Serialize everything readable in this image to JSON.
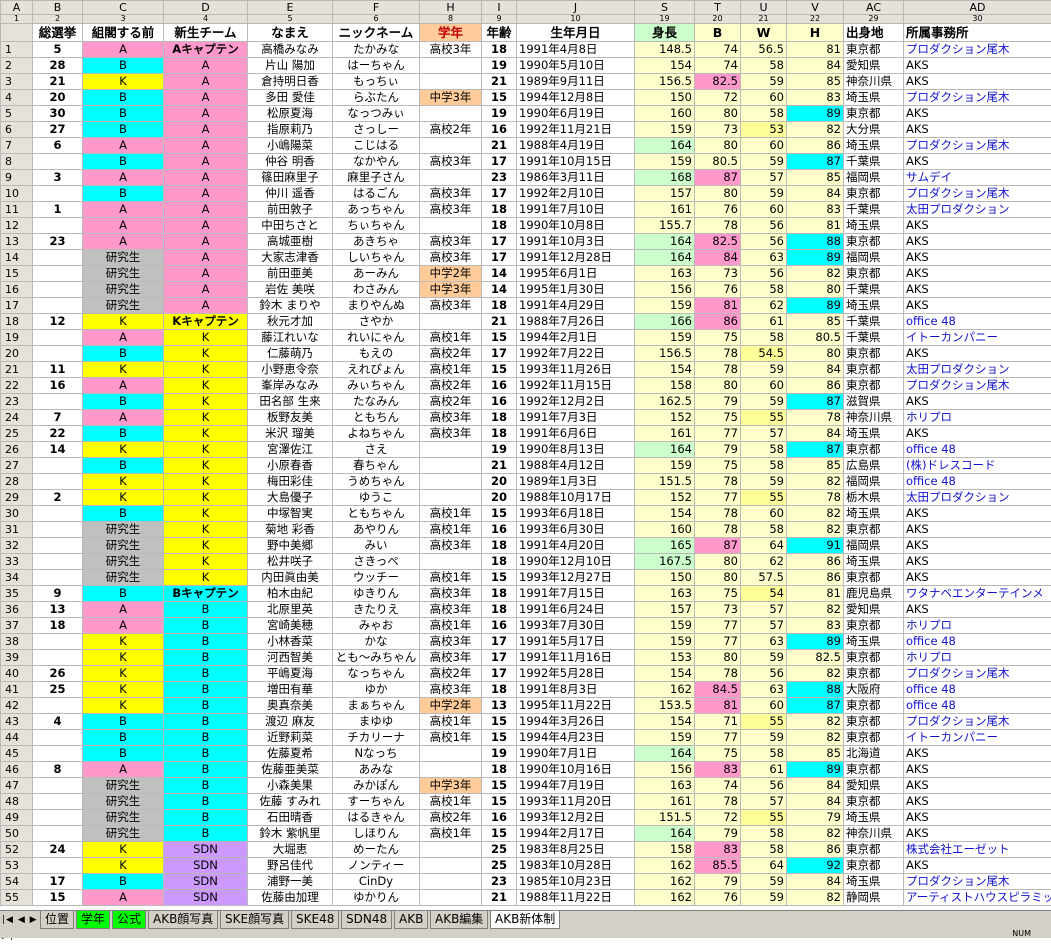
{
  "columns": [
    {
      "letter": "A",
      "num": "1"
    },
    {
      "letter": "B",
      "num": "2"
    },
    {
      "letter": "C",
      "num": "3"
    },
    {
      "letter": "D",
      "num": "4"
    },
    {
      "letter": "E",
      "num": "5"
    },
    {
      "letter": "F",
      "num": "6"
    },
    {
      "letter": "H",
      "num": "8"
    },
    {
      "letter": "I",
      "num": "9"
    },
    {
      "letter": "J",
      "num": "10"
    },
    {
      "letter": "S",
      "num": "19"
    },
    {
      "letter": "T",
      "num": "20"
    },
    {
      "letter": "U",
      "num": "21"
    },
    {
      "letter": "V",
      "num": "22"
    },
    {
      "letter": "AC",
      "num": "29"
    },
    {
      "letter": "AD",
      "num": "30"
    }
  ],
  "headers": [
    "",
    "総選挙",
    "組閣する前",
    "新生チーム",
    "なまえ",
    "ニックネーム",
    "学年",
    "年齢",
    "生年月日",
    "身長",
    "B",
    "W",
    "H",
    "出身地",
    "所属事務所"
  ],
  "colors": {
    "A": "#ff99cc",
    "B": "#00ffff",
    "K": "#ffff00",
    "SDN": "#cc99ff",
    "study": "#c0c0c0",
    "grade": "#ffcc99",
    "tall": "#ccffcc",
    "mid": "#ff99cc",
    "waist": "#ffff99",
    "hip": "#00ffff",
    "meas": "#ffffcc",
    "link": "#1010cc"
  },
  "rows": [
    [
      "1",
      "5",
      "A",
      "Aキャプテン",
      "高橋みなみ",
      "たかみな",
      "高校3年",
      "18",
      "1991年4月8日",
      "148.5",
      "74",
      "56.5",
      "81",
      "東京都",
      "プロダクション尾木"
    ],
    [
      "2",
      "28",
      "B",
      "A",
      "片山 陽加",
      "はーちゃん",
      "",
      "19",
      "1990年5月10日",
      "154",
      "74",
      "58",
      "84",
      "愛知県",
      "AKS"
    ],
    [
      "3",
      "21",
      "K",
      "A",
      "倉持明日香",
      "もっちぃ",
      "",
      "21",
      "1989年9月11日",
      "156.5",
      "82.5",
      "59",
      "85",
      "神奈川県",
      "AKS"
    ],
    [
      "4",
      "20",
      "B",
      "A",
      "多田 愛佳",
      "らぶたん",
      "中学3年",
      "15",
      "1994年12月8日",
      "150",
      "72",
      "60",
      "83",
      "埼玉県",
      "プロダクション尾木"
    ],
    [
      "5",
      "30",
      "B",
      "A",
      "松原夏海",
      "なっつみぃ",
      "",
      "19",
      "1990年6月19日",
      "160",
      "80",
      "58",
      "89",
      "東京都",
      "AKS"
    ],
    [
      "6",
      "27",
      "B",
      "A",
      "指原莉乃",
      "さっしー",
      "高校2年",
      "16",
      "1992年11月21日",
      "159",
      "73",
      "53",
      "82",
      "大分県",
      "AKS"
    ],
    [
      "7",
      "6",
      "A",
      "A",
      "小嶋陽菜",
      "こじはる",
      "",
      "21",
      "1988年4月19日",
      "164",
      "80",
      "60",
      "86",
      "埼玉県",
      "プロダクション尾木"
    ],
    [
      "8",
      "",
      "B",
      "A",
      "仲谷 明香",
      "なかやん",
      "高校3年",
      "17",
      "1991年10月15日",
      "159",
      "80.5",
      "59",
      "87",
      "千葉県",
      "AKS"
    ],
    [
      "9",
      "3",
      "A",
      "A",
      "篠田麻里子",
      "麻里子さん",
      "",
      "23",
      "1986年3月11日",
      "168",
      "87",
      "57",
      "85",
      "福岡県",
      "サムデイ"
    ],
    [
      "10",
      "",
      "B",
      "A",
      "仲川 遥香",
      "はるごん",
      "高校3年",
      "17",
      "1992年2月10日",
      "157",
      "80",
      "59",
      "84",
      "東京都",
      "プロダクション尾木"
    ],
    [
      "11",
      "1",
      "A",
      "A",
      "前田敦子",
      "あっちゃん",
      "高校3年",
      "18",
      "1991年7月10日",
      "161",
      "76",
      "60",
      "83",
      "千葉県",
      "太田プロダクション"
    ],
    [
      "12",
      "",
      "A",
      "A",
      "中田ちさと",
      "ちぃちゃん",
      "",
      "18",
      "1990年10月8日",
      "155.7",
      "78",
      "56",
      "81",
      "埼玉県",
      "AKS"
    ],
    [
      "13",
      "23",
      "A",
      "A",
      "高城亜樹",
      "あきちゃ",
      "高校3年",
      "17",
      "1991年10月3日",
      "164",
      "82.5",
      "56",
      "88",
      "東京都",
      "AKS"
    ],
    [
      "14",
      "",
      "研究生",
      "A",
      "大家志津香",
      "しいちゃん",
      "高校3年",
      "17",
      "1991年12月28日",
      "164",
      "84",
      "63",
      "89",
      "福岡県",
      "AKS"
    ],
    [
      "15",
      "",
      "研究生",
      "A",
      "前田亜美",
      "あーみん",
      "中学2年",
      "14",
      "1995年6月1日",
      "163",
      "73",
      "56",
      "82",
      "東京都",
      "AKS"
    ],
    [
      "16",
      "",
      "研究生",
      "A",
      "岩佐 美咲",
      "わさみん",
      "中学3年",
      "14",
      "1995年1月30日",
      "156",
      "76",
      "58",
      "80",
      "千葉県",
      "AKS"
    ],
    [
      "17",
      "",
      "研究生",
      "A",
      "鈴木 まりや",
      "まりやんぬ",
      "高校3年",
      "18",
      "1991年4月29日",
      "159",
      "81",
      "62",
      "89",
      "埼玉県",
      "AKS"
    ],
    [
      "18",
      "12",
      "K",
      "Kキャプテン",
      "秋元才加",
      "さやか",
      "",
      "21",
      "1988年7月26日",
      "166",
      "86",
      "61",
      "85",
      "千葉県",
      "office 48"
    ],
    [
      "19",
      "",
      "A",
      "K",
      "藤江れいな",
      "れいにゃん",
      "高校1年",
      "15",
      "1994年2月1日",
      "159",
      "75",
      "58",
      "80.5",
      "千葉県",
      "イトーカンパニー"
    ],
    [
      "20",
      "",
      "B",
      "K",
      "仁藤萌乃",
      "もえの",
      "高校2年",
      "17",
      "1992年7月22日",
      "156.5",
      "78",
      "54.5",
      "80",
      "東京都",
      "AKS"
    ],
    [
      "21",
      "11",
      "K",
      "K",
      "小野恵令奈",
      "えれぴょん",
      "高校1年",
      "15",
      "1993年11月26日",
      "154",
      "78",
      "59",
      "84",
      "東京都",
      "太田プロダクション"
    ],
    [
      "22",
      "16",
      "A",
      "K",
      "峯岸みなみ",
      "みぃちゃん",
      "高校2年",
      "16",
      "1992年11月15日",
      "158",
      "80",
      "60",
      "86",
      "東京都",
      "プロダクション尾木"
    ],
    [
      "23",
      "",
      "B",
      "K",
      "田名部 生来",
      "たなみん",
      "高校2年",
      "16",
      "1992年12月2日",
      "162.5",
      "79",
      "59",
      "87",
      "滋賀県",
      "AKS"
    ],
    [
      "24",
      "7",
      "A",
      "K",
      "板野友美",
      "ともちん",
      "高校3年",
      "18",
      "1991年7月3日",
      "152",
      "75",
      "55",
      "78",
      "神奈川県",
      "ホリプロ"
    ],
    [
      "25",
      "22",
      "B",
      "K",
      "米沢 瑠美",
      "よねちゃん",
      "高校3年",
      "18",
      "1991年6月6日",
      "161",
      "77",
      "57",
      "84",
      "埼玉県",
      "AKS"
    ],
    [
      "26",
      "14",
      "K",
      "K",
      "宮澤佐江",
      "さえ",
      "",
      "19",
      "1990年8月13日",
      "164",
      "79",
      "58",
      "87",
      "東京都",
      "office 48"
    ],
    [
      "27",
      "",
      "B",
      "K",
      "小原春香",
      "春ちゃん",
      "",
      "21",
      "1988年4月12日",
      "159",
      "75",
      "58",
      "85",
      "広島県",
      "(株)ドレスコード"
    ],
    [
      "28",
      "",
      "K",
      "K",
      "梅田彩佳",
      "うめちゃん",
      "",
      "20",
      "1989年1月3日",
      "151.5",
      "78",
      "59",
      "82",
      "福岡県",
      "office 48"
    ],
    [
      "29",
      "2",
      "K",
      "K",
      "大島優子",
      "ゆうこ",
      "",
      "20",
      "1988年10月17日",
      "152",
      "77",
      "55",
      "78",
      "栃木県",
      "太田プロダクション"
    ],
    [
      "30",
      "",
      "B",
      "K",
      "中塚智実",
      "ともちゃん",
      "高校1年",
      "15",
      "1993年6月18日",
      "154",
      "78",
      "60",
      "82",
      "埼玉県",
      "AKS"
    ],
    [
      "31",
      "",
      "研究生",
      "K",
      "菊地 彩香",
      "あやりん",
      "高校1年",
      "16",
      "1993年6月30日",
      "160",
      "78",
      "58",
      "82",
      "東京都",
      "AKS"
    ],
    [
      "32",
      "",
      "研究生",
      "K",
      "野中美郷",
      "みい",
      "高校3年",
      "18",
      "1991年4月20日",
      "165",
      "87",
      "64",
      "91",
      "福岡県",
      "AKS"
    ],
    [
      "33",
      "",
      "研究生",
      "K",
      "松井咲子",
      "さきっぺ",
      "",
      "18",
      "1990年12月10日",
      "167.5",
      "80",
      "62",
      "86",
      "埼玉県",
      "AKS"
    ],
    [
      "34",
      "",
      "研究生",
      "K",
      "内田眞由美",
      "ウッチー",
      "高校1年",
      "15",
      "1993年12月27日",
      "150",
      "80",
      "57.5",
      "86",
      "東京都",
      "AKS"
    ],
    [
      "35",
      "9",
      "B",
      "Bキャプテン",
      "柏木由紀",
      "ゆきりん",
      "高校3年",
      "18",
      "1991年7月15日",
      "163",
      "75",
      "54",
      "81",
      "鹿児島県",
      "ワタナベエンターテインメ"
    ],
    [
      "36",
      "13",
      "A",
      "B",
      "北原里英",
      "きたりえ",
      "高校3年",
      "18",
      "1991年6月24日",
      "157",
      "73",
      "57",
      "82",
      "愛知県",
      "AKS"
    ],
    [
      "37",
      "18",
      "A",
      "B",
      "宮崎美穂",
      "みゃお",
      "高校1年",
      "16",
      "1993年7月30日",
      "159",
      "77",
      "57",
      "83",
      "東京都",
      "ホリプロ"
    ],
    [
      "38",
      "",
      "K",
      "B",
      "小林香菜",
      "かな",
      "高校3年",
      "17",
      "1991年5月17日",
      "159",
      "77",
      "63",
      "89",
      "埼玉県",
      "office 48"
    ],
    [
      "39",
      "",
      "K",
      "B",
      "河西智美",
      "とも〜みちゃん",
      "高校3年",
      "17",
      "1991年11月16日",
      "153",
      "80",
      "59",
      "82.5",
      "東京都",
      "ホリプロ"
    ],
    [
      "40",
      "26",
      "K",
      "B",
      "平嶋夏海",
      "なっちゃん",
      "高校2年",
      "17",
      "1992年5月28日",
      "154",
      "78",
      "56",
      "82",
      "東京都",
      "プロダクション尾木"
    ],
    [
      "41",
      "25",
      "K",
      "B",
      "増田有華",
      "ゆか",
      "高校3年",
      "18",
      "1991年8月3日",
      "162",
      "84.5",
      "63",
      "88",
      "大阪府",
      "office 48"
    ],
    [
      "42",
      "",
      "K",
      "B",
      "奥真奈美",
      "まぁちゃん",
      "中学2年",
      "13",
      "1995年11月22日",
      "153.5",
      "81",
      "60",
      "87",
      "東京都",
      "office 48"
    ],
    [
      "43",
      "4",
      "B",
      "B",
      "渡辺 麻友",
      "まゆゆ",
      "高校1年",
      "15",
      "1994年3月26日",
      "154",
      "71",
      "55",
      "82",
      "東京都",
      "プロダクション尾木"
    ],
    [
      "44",
      "",
      "B",
      "B",
      "近野莉菜",
      "チカリーナ",
      "高校1年",
      "15",
      "1994年4月23日",
      "159",
      "77",
      "59",
      "82",
      "東京都",
      "イトーカンパニー"
    ],
    [
      "45",
      "",
      "B",
      "B",
      "佐藤夏希",
      "Nなっち",
      "",
      "19",
      "1990年7月1日",
      "164",
      "75",
      "58",
      "85",
      "北海道",
      "AKS"
    ],
    [
      "46",
      "8",
      "A",
      "B",
      "佐藤亜美菜",
      "あみな",
      "",
      "18",
      "1990年10月16日",
      "156",
      "83",
      "61",
      "89",
      "東京都",
      "AKS"
    ],
    [
      "47",
      "",
      "研究生",
      "B",
      "小森美果",
      "みかぽん",
      "中学3年",
      "15",
      "1994年7月19日",
      "163",
      "74",
      "56",
      "84",
      "愛知県",
      "AKS"
    ],
    [
      "48",
      "",
      "研究生",
      "B",
      "佐藤 すみれ",
      "すーちゃん",
      "高校1年",
      "15",
      "1993年11月20日",
      "161",
      "78",
      "57",
      "84",
      "東京都",
      "AKS"
    ],
    [
      "49",
      "",
      "研究生",
      "B",
      "石田晴香",
      "はるきゃん",
      "高校2年",
      "16",
      "1993年12月2日",
      "151.5",
      "72",
      "55",
      "79",
      "埼玉県",
      "AKS"
    ],
    [
      "50",
      "",
      "研究生",
      "B",
      "鈴木 紫帆里",
      "しほりん",
      "高校1年",
      "15",
      "1994年2月17日",
      "164",
      "79",
      "58",
      "82",
      "神奈川県",
      "AKS"
    ],
    [
      "52",
      "24",
      "K",
      "SDN",
      "大堀恵",
      "めーたん",
      "",
      "25",
      "1983年8月25日",
      "158",
      "83",
      "58",
      "86",
      "東京都",
      "株式会社エーゼット"
    ],
    [
      "53",
      "",
      "K",
      "SDN",
      "野呂佳代",
      "ノンティー",
      "",
      "25",
      "1983年10月28日",
      "162",
      "85.5",
      "64",
      "92",
      "東京都",
      "AKS"
    ],
    [
      "54",
      "17",
      "B",
      "SDN",
      "浦野一美",
      "CinDy",
      "",
      "23",
      "1985年10月23日",
      "162",
      "79",
      "59",
      "84",
      "埼玉県",
      "プロダクション尾木"
    ],
    [
      "55",
      "15",
      "A",
      "SDN",
      "佐藤由加理",
      "ゆかりん",
      "",
      "21",
      "1988年11月22日",
      "162",
      "76",
      "59",
      "82",
      "静岡県",
      "アーティストハウスピラミッ"
    ]
  ],
  "sheet_tabs": [
    "位置",
    "学年",
    "公式",
    "AKB顔写真",
    "SKE顔写真",
    "SKE48",
    "SDN48",
    "AKB",
    "AKB編集",
    "AKB新体制"
  ],
  "status_text": "NUM"
}
